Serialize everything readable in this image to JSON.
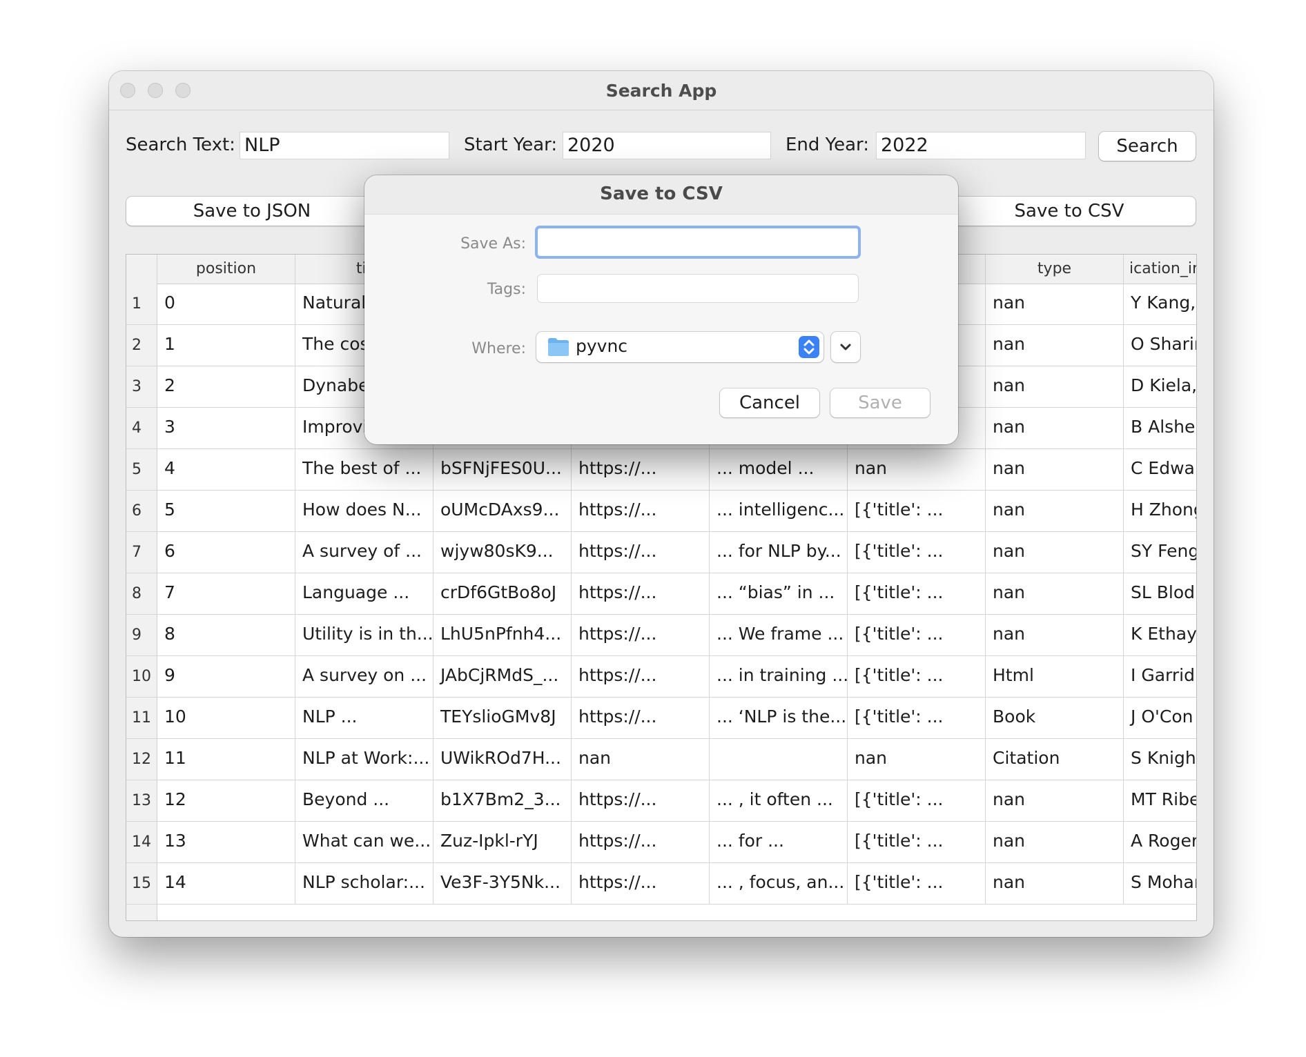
{
  "window": {
    "title": "Search App"
  },
  "search": {
    "text_label": "Search Text:",
    "text_value": "NLP",
    "start_label": "Start Year:",
    "start_value": "2020",
    "end_label": "End Year:",
    "end_value": "2022",
    "button": "Search"
  },
  "actions": {
    "save_json": "Save to JSON",
    "save_csv": "Save to CSV"
  },
  "table": {
    "columns": [
      "position",
      "tit",
      "",
      "",
      "",
      "",
      "type",
      "ication_ir"
    ],
    "rows": [
      {
        "n": "1",
        "cells": [
          "0",
          "Natural",
          "",
          "",
          "",
          "",
          "nan",
          "Y Kang,"
        ]
      },
      {
        "n": "2",
        "cells": [
          "1",
          "The cos",
          "",
          "",
          "",
          "",
          "nan",
          "O Sharir"
        ]
      },
      {
        "n": "3",
        "cells": [
          "2",
          "Dynabe",
          "",
          "",
          "",
          "",
          "nan",
          "D Kiela,"
        ]
      },
      {
        "n": "4",
        "cells": [
          "3",
          "Improvi",
          "",
          "",
          "",
          "",
          "nan",
          "B Alsher"
        ]
      },
      {
        "n": "5",
        "cells": [
          "4",
          "The best of ...",
          "bSFNjFES0U...",
          "https://...",
          "... model ...",
          "nan",
          "nan",
          "C Edwar"
        ]
      },
      {
        "n": "6",
        "cells": [
          "5",
          "How does N...",
          "oUMcDAxs9...",
          "https://...",
          "... intelligenc...",
          "[{'title': ...",
          "nan",
          "H Zhong"
        ]
      },
      {
        "n": "7",
        "cells": [
          "6",
          "A survey of ...",
          "wjyw80sK9...",
          "https://...",
          "... for NLP by...",
          "[{'title': ...",
          "nan",
          "SY Feng"
        ]
      },
      {
        "n": "8",
        "cells": [
          "7",
          "Language ...",
          "crDf6GtBo8oJ",
          "https://...",
          "... “bias” in ...",
          "[{'title': ...",
          "nan",
          "SL Blod"
        ]
      },
      {
        "n": "9",
        "cells": [
          "8",
          "Utility is in th...",
          "LhU5nPfnh4...",
          "https://...",
          "... We frame ...",
          "[{'title': ...",
          "nan",
          "K Ethay"
        ]
      },
      {
        "n": "10",
        "cells": [
          "9",
          "A survey on ...",
          "JAbCjRMdS_...",
          "https://...",
          "... in training ...",
          "[{'title': ...",
          "Html",
          "I Garrid"
        ]
      },
      {
        "n": "11",
        "cells": [
          "10",
          "NLP ...",
          "TEYslioGMv8J",
          "https://...",
          "... ‘NLP is the...",
          "[{'title': ...",
          "Book",
          "J O'Con"
        ]
      },
      {
        "n": "12",
        "cells": [
          "11",
          "NLP at Work:...",
          "UWikROd7H...",
          "nan",
          "",
          "nan",
          "Citation",
          "S Knigh"
        ]
      },
      {
        "n": "13",
        "cells": [
          "12",
          "Beyond ...",
          "b1X7Bm2_3...",
          "https://...",
          "... , it often ...",
          "[{'title': ...",
          "nan",
          "MT Ribe"
        ]
      },
      {
        "n": "14",
        "cells": [
          "13",
          "What can we...",
          "Zuz-Ipkl-rYJ",
          "https://...",
          "... for ...",
          "[{'title': ...",
          "nan",
          "A Roger"
        ]
      },
      {
        "n": "15",
        "cells": [
          "14",
          "NLP scholar:...",
          "Ve3F-3Y5Nk...",
          "https://...",
          "... , focus, an...",
          "[{'title': ...",
          "nan",
          "S Mohar"
        ]
      }
    ]
  },
  "dialog": {
    "title": "Save to CSV",
    "save_as_label": "Save As:",
    "save_as_value": "",
    "tags_label": "Tags:",
    "tags_value": "",
    "where_label": "Where:",
    "where_value": "pyvnc",
    "cancel": "Cancel",
    "save": "Save"
  },
  "colors": {
    "accent": "#3b82f6",
    "focus_ring": "#8bb2f2",
    "folder": "#6cb2f0"
  }
}
